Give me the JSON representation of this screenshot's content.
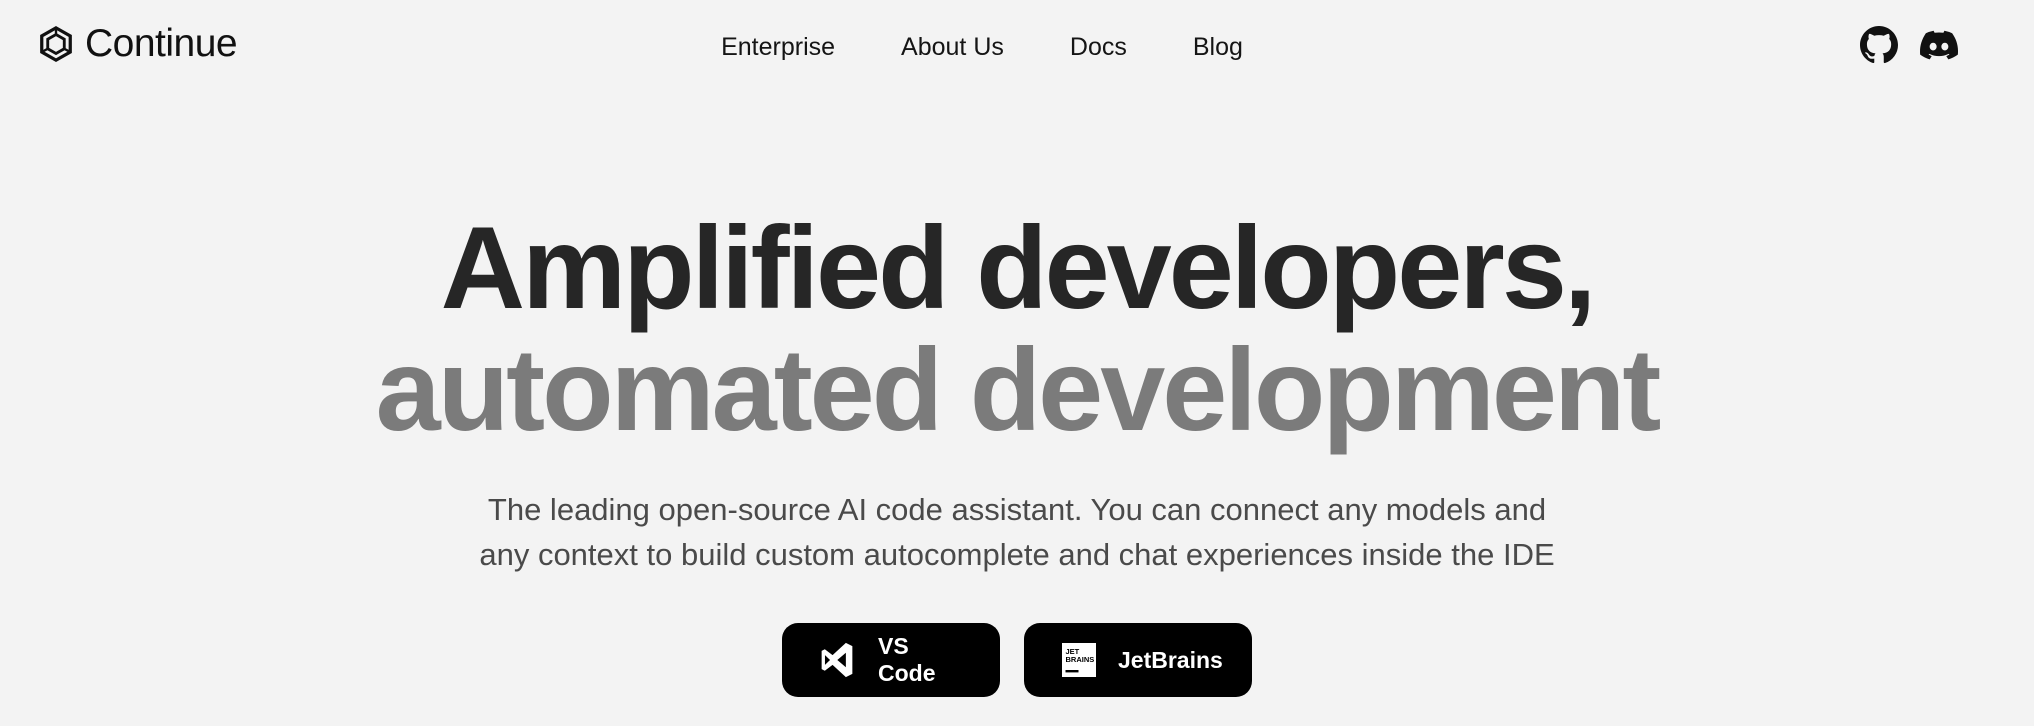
{
  "header": {
    "logo_text": "Continue",
    "logo_icon": "continue-hexagon-logo",
    "nav": [
      {
        "label": "Enterprise"
      },
      {
        "label": "About Us"
      },
      {
        "label": "Docs"
      },
      {
        "label": "Blog"
      }
    ],
    "social": [
      {
        "icon": "github-icon"
      },
      {
        "icon": "discord-icon"
      }
    ]
  },
  "hero": {
    "line1": "Amplified developers,",
    "line2": "automated development",
    "subtitle_line1": "The leading open-source AI code assistant. You can connect any models and",
    "subtitle_line2": "any context to build custom autocomplete and chat experiences inside the IDE"
  },
  "ctas": [
    {
      "label": "VS Code",
      "icon": "vscode-icon"
    },
    {
      "label": "JetBrains",
      "icon": "jetbrains-icon",
      "icon_text": "JET BRAINS"
    }
  ],
  "colors": {
    "background": "#f3f3f3",
    "headline_dark": "#262626",
    "headline_gray": "#7b7b7b",
    "button_bg": "#000000"
  }
}
